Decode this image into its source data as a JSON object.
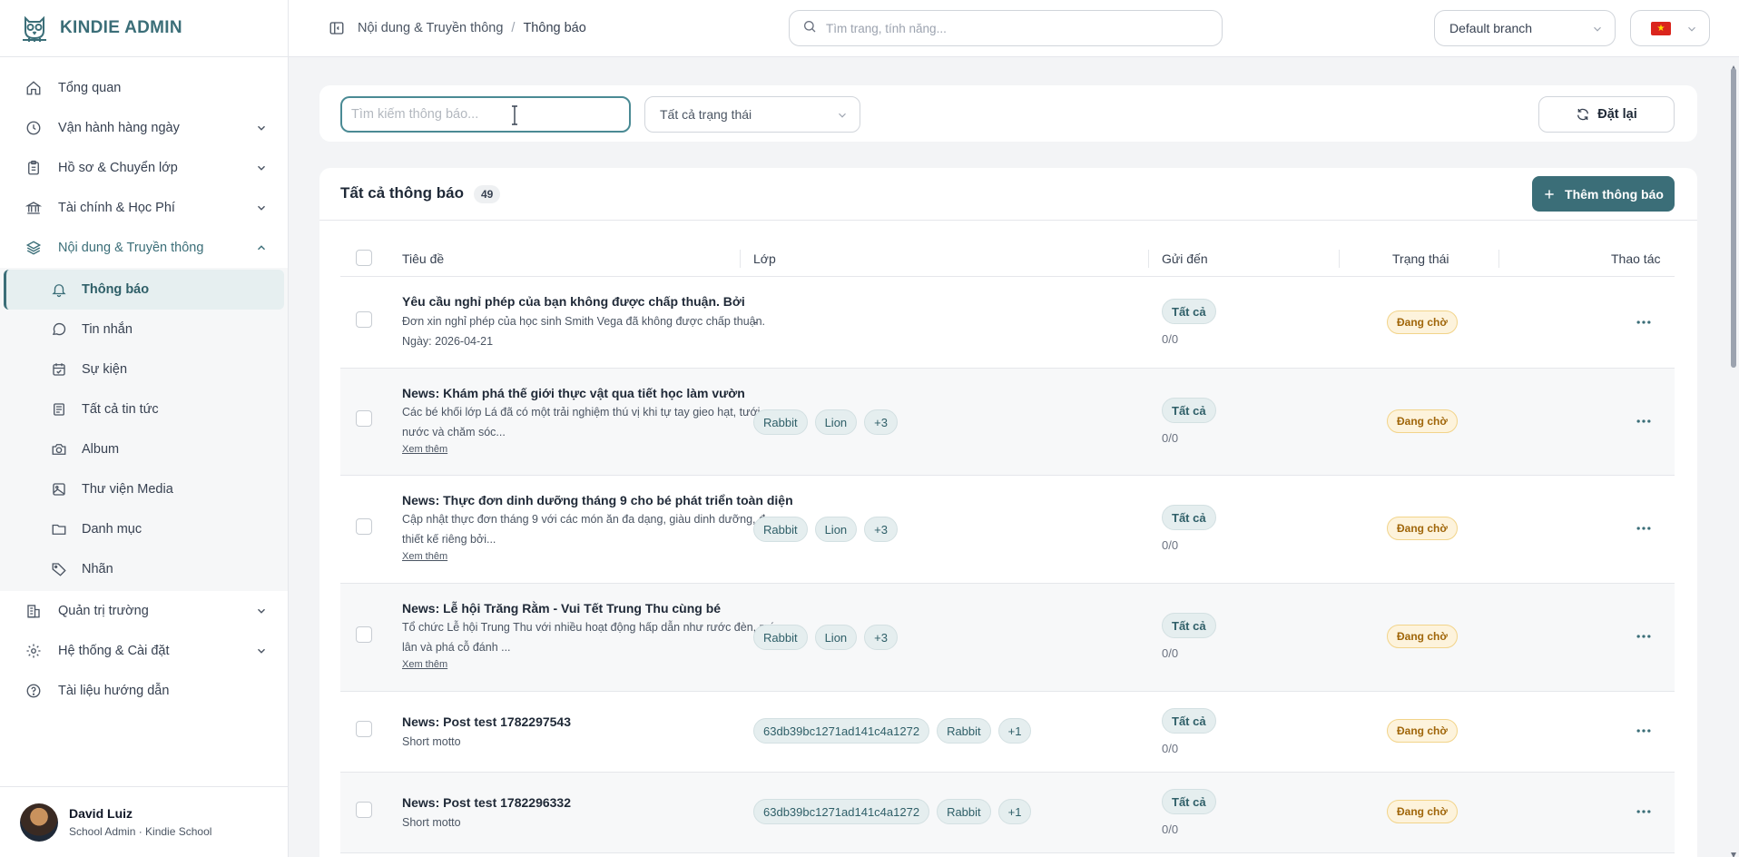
{
  "brand": {
    "name": "KINDIE ADMIN"
  },
  "sidebar": {
    "items": [
      {
        "label": "Tổng quan",
        "icon": "home-icon",
        "has_children": false
      },
      {
        "label": "Vận hành hàng ngày",
        "icon": "clock-icon",
        "has_children": true
      },
      {
        "label": "Hồ sơ & Chuyển lớp",
        "icon": "clipboard-icon",
        "has_children": true
      },
      {
        "label": "Tài chính & Học Phí",
        "icon": "bank-icon",
        "has_children": true
      },
      {
        "label": "Nội dung & Truyền thông",
        "icon": "layers-icon",
        "has_children": true,
        "expanded": true
      }
    ],
    "sub_items": [
      {
        "label": "Thông báo",
        "icon": "bell-icon",
        "active": true
      },
      {
        "label": "Tin nhắn",
        "icon": "message-icon"
      },
      {
        "label": "Sự kiện",
        "icon": "calendar-icon"
      },
      {
        "label": "Tất cả tin tức",
        "icon": "newspaper-icon"
      },
      {
        "label": "Album",
        "icon": "camera-icon"
      },
      {
        "label": "Thư viện Media",
        "icon": "image-icon"
      },
      {
        "label": "Danh mục",
        "icon": "folder-icon"
      },
      {
        "label": "Nhãn",
        "icon": "tag-icon"
      }
    ],
    "bottom_items": [
      {
        "label": "Quản trị trường",
        "icon": "building-icon",
        "has_children": true
      },
      {
        "label": "Hệ thống & Cài đặt",
        "icon": "gear-icon",
        "has_children": true
      },
      {
        "label": "Tài liệu hướng dẫn",
        "icon": "help-circle-icon",
        "has_children": false
      }
    ],
    "user": {
      "name": "David Luiz",
      "role": "School Admin · Kindie School"
    }
  },
  "header": {
    "breadcrumb": [
      "Nội dung & Truyền thông",
      "Thông báo"
    ],
    "breadcrumb_sep": "/",
    "search_placeholder": "Tìm trang, tính năng...",
    "branch": "Default branch",
    "flag_star": "★"
  },
  "filters": {
    "search_placeholder": "Tìm kiếm thông báo...",
    "status": "Tất cả trạng thái",
    "reset_label": "Đặt lại"
  },
  "table": {
    "title": "Tất cả thông báo",
    "count": "49",
    "add_label": "Thêm thông báo",
    "more_label": "Xem thêm",
    "columns": [
      "Tiêu đề",
      "Lớp",
      "Gửi đến",
      "Trạng thái",
      "Thao tác"
    ],
    "rows": [
      {
        "title": "Yêu cầu nghỉ phép của bạn không được chấp thuận. Bởi",
        "desc": [
          "Đơn xin nghỉ phép của học sinh Smith Vega đã không được chấp thuận.",
          "Ngày: 2026-04-21"
        ],
        "more": false,
        "classes": [],
        "empty_class": "-",
        "send": "Tất cả",
        "send_count": "0/0",
        "status": "Đang chờ"
      },
      {
        "title": "News: Khám phá thế giới thực vật qua tiết học làm vườn",
        "desc": [
          "Các bé khối lớp Lá đã có một trải nghiệm thú vị khi tự tay gieo hạt, tưới",
          "nước và chăm sóc..."
        ],
        "more": true,
        "classes": [
          "Rabbit",
          "Lion",
          "+3"
        ],
        "send": "Tất cả",
        "send_count": "0/0",
        "status": "Đang chờ"
      },
      {
        "title": "News: Thực đơn dinh dưỡng tháng 9 cho bé phát triển toàn diện",
        "desc": [
          "Cập nhật thực đơn tháng 9 với các món ăn đa dạng, giàu dinh dưỡng, được",
          "thiết kế riêng bởi..."
        ],
        "more": true,
        "classes": [
          "Rabbit",
          "Lion",
          "+3"
        ],
        "send": "Tất cả",
        "send_count": "0/0",
        "status": "Đang chờ"
      },
      {
        "title": "News: Lễ hội Trăng Rằm - Vui Tết Trung Thu cùng bé",
        "desc": [
          "Tổ chức Lễ hội Trung Thu với nhiều hoạt động hấp dẫn như rước đèn, múa",
          "lân và phá cỗ đánh ..."
        ],
        "more": true,
        "classes": [
          "Rabbit",
          "Lion",
          "+3"
        ],
        "send": "Tất cả",
        "send_count": "0/0",
        "status": "Đang chờ"
      },
      {
        "title": "News: Post test 1782297543",
        "desc": [
          "Short motto"
        ],
        "more": false,
        "classes": [
          "63db39bc1271ad141c4a1272",
          "Rabbit",
          "+1"
        ],
        "send": "Tất cả",
        "send_count": "0/0",
        "status": "Đang chờ"
      },
      {
        "title": "News: Post test 1782296332",
        "desc": [
          "Short motto"
        ],
        "more": false,
        "classes": [
          "63db39bc1271ad141c4a1272",
          "Rabbit",
          "+1"
        ],
        "send": "Tất cả",
        "send_count": "0/0",
        "status": "Đang chờ"
      }
    ]
  },
  "colors": {
    "accent": "#3b6e78",
    "pending_bg": "#fdf3dc",
    "pending_text": "#a0660a"
  }
}
